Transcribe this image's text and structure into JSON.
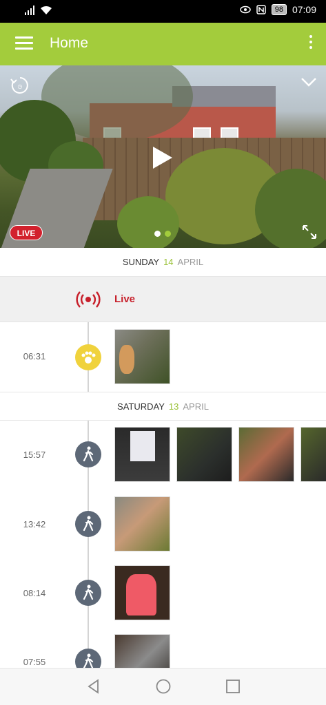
{
  "status_bar": {
    "time": "07:09",
    "battery": "98"
  },
  "app_bar": {
    "title": "Home"
  },
  "video": {
    "live_badge": "LIVE"
  },
  "days": [
    {
      "day": "SUNDAY",
      "date": "14",
      "month": "APRIL"
    },
    {
      "day": "SATURDAY",
      "date": "13",
      "month": "APRIL"
    }
  ],
  "live_row": {
    "label": "Live"
  },
  "events": [
    {
      "time": "06:31",
      "type": "pet",
      "thumb_count": 1
    },
    {
      "time": "15:57",
      "type": "person",
      "thumb_count": 4
    },
    {
      "time": "13:42",
      "type": "person",
      "thumb_count": 1
    },
    {
      "time": "08:14",
      "type": "person",
      "thumb_count": 1
    },
    {
      "time": "07:55",
      "type": "person",
      "thumb_count": 1
    }
  ],
  "colors": {
    "accent": "#a3cc3c",
    "live_red": "#d2212d",
    "pet_yellow": "#f0d23c",
    "person_gray": "#5d6877"
  }
}
